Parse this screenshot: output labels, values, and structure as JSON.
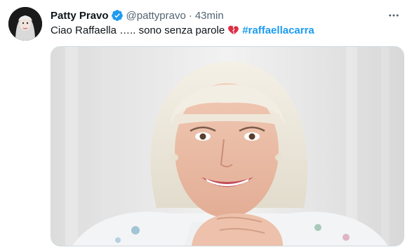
{
  "tweet": {
    "author_name": "Patty Pravo",
    "handle": "@pattypravo",
    "separator": "·",
    "time": "43min",
    "text_before": "Ciao Raffaella ….. sono senza parole",
    "emoji": "broken-heart",
    "hashtag": "#raffaellacarra"
  },
  "icons": {
    "verified": "verified-badge-icon",
    "more": "more-horizontal-icon",
    "emoji": "broken-heart-icon"
  },
  "colors": {
    "link": "#1d9bf0",
    "muted": "#536471",
    "text": "#0f1419",
    "verified": "#1d9bf0",
    "heart": "#e0245e"
  }
}
